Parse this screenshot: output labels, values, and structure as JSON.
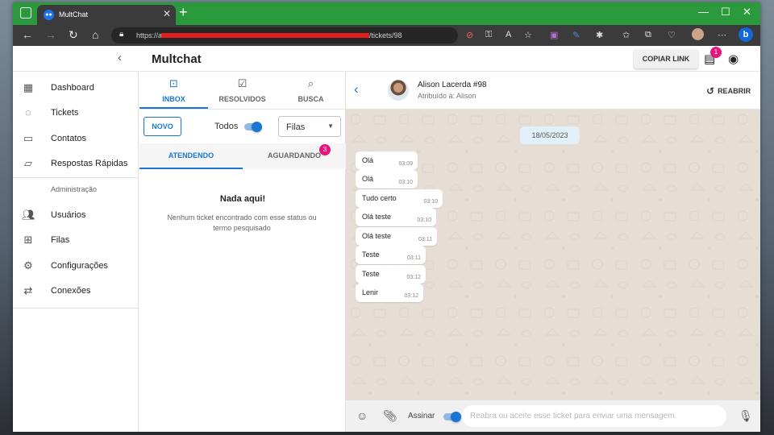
{
  "browser": {
    "tab_title": "MultChat",
    "tab_favicon": "chat-favicon",
    "url_prefix": "https://a",
    "url_suffix": "/tickets/98",
    "url_redacted": true
  },
  "header": {
    "title": "Multchat",
    "copy_link_label": "COPIAR LINK",
    "notification_count": "1"
  },
  "sidebar": {
    "items": [
      {
        "label": "Dashboard",
        "icon": "dashboard-icon"
      },
      {
        "label": "Tickets",
        "icon": "whatsapp-icon"
      },
      {
        "label": "Contatos",
        "icon": "contacts-icon"
      },
      {
        "label": "Respostas Rápidas",
        "icon": "quick-reply-icon"
      }
    ],
    "section_label": "Administração",
    "admin_items": [
      {
        "label": "Usuários",
        "icon": "users-icon"
      },
      {
        "label": "Filas",
        "icon": "queues-icon"
      },
      {
        "label": "Configurações",
        "icon": "settings-icon"
      },
      {
        "label": "Conexões",
        "icon": "connections-icon"
      }
    ]
  },
  "tickets": {
    "tabs": [
      {
        "label": "INBOX",
        "active": true
      },
      {
        "label": "RESOLVIDOS",
        "active": false
      },
      {
        "label": "BUSCA",
        "active": false
      }
    ],
    "new_label": "NOVO",
    "todos_label": "Todos",
    "todos_on": true,
    "queue_select": "Filas",
    "subtabs": [
      {
        "label": "ATENDENDO",
        "active": true
      },
      {
        "label": "AGUARDANDO",
        "active": false,
        "badge": "3"
      }
    ],
    "empty_title": "Nada aqui!",
    "empty_text": "Nenhum ticket encontrado com esse status ou termo pesquisado"
  },
  "chat": {
    "contact_name": "Alison Lacerda #98",
    "assigned": "Atribuído à: Alison",
    "reopen_label": "REABRIR",
    "date": "18/05/2023",
    "messages": [
      {
        "text": "Olá",
        "time": "03:09"
      },
      {
        "text": "Olá",
        "time": "03:10"
      },
      {
        "text": "Tudo certo",
        "time": "03:10"
      },
      {
        "text": "Olá teste",
        "time": "03:10"
      },
      {
        "text": "Olá teste",
        "time": "03:11"
      },
      {
        "text": "Teste",
        "time": "03:11"
      },
      {
        "text": "Teste",
        "time": "03:12"
      },
      {
        "text": "Lenir",
        "time": "03:12"
      }
    ],
    "sign_label": "Assinar",
    "sign_on": true,
    "input_placeholder": "Reabra ou aceite esse ticket para enviar uma mensagem."
  },
  "colors": {
    "accent": "#1976d2",
    "badge": "#e6157d",
    "browser_frame": "#2b9a3d",
    "chat_background": "#e6ded5"
  }
}
